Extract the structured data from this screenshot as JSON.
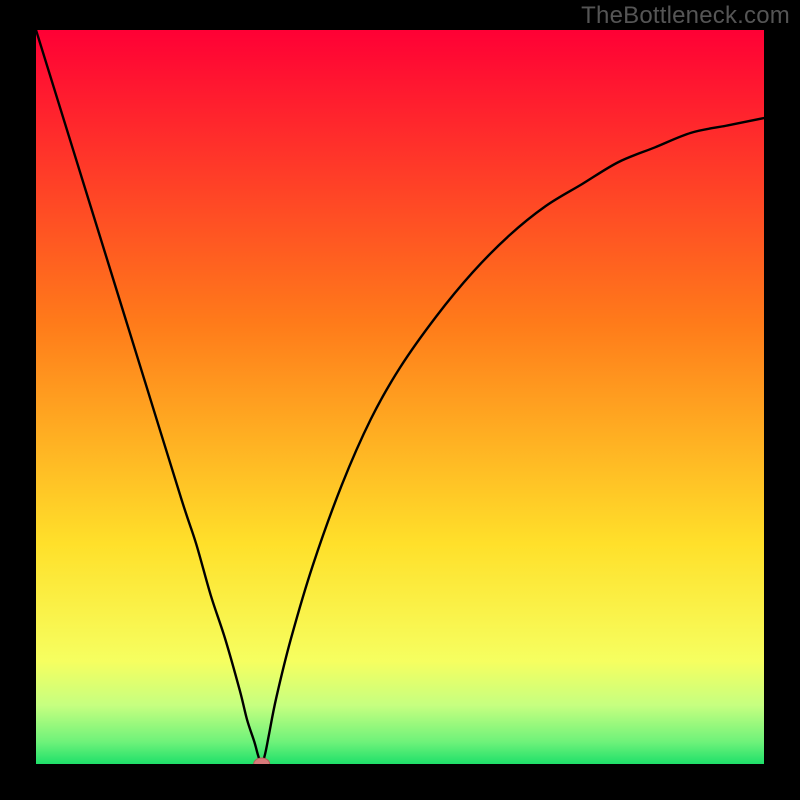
{
  "watermark": "TheBottleneck.com",
  "colors": {
    "frame": "#000000",
    "curve": "#000000",
    "marker_fill": "#d77a7a",
    "marker_stroke": "#b85a5a",
    "gradient_stops": [
      {
        "offset": 0,
        "color": "#ff0035"
      },
      {
        "offset": 40,
        "color": "#ff7b1a"
      },
      {
        "offset": 70,
        "color": "#ffe02a"
      },
      {
        "offset": 86,
        "color": "#f6ff60"
      },
      {
        "offset": 92,
        "color": "#c6ff80"
      },
      {
        "offset": 97,
        "color": "#6ef27a"
      },
      {
        "offset": 100,
        "color": "#1fe06a"
      }
    ]
  },
  "chart_data": {
    "type": "line",
    "title": "",
    "xlabel": "",
    "ylabel": "",
    "xlim": [
      0,
      100
    ],
    "ylim": [
      0,
      100
    ],
    "series": [
      {
        "name": "bottleneck-curve",
        "x": [
          0,
          5,
          10,
          15,
          20,
          22,
          24,
          26,
          28,
          29,
          30,
          30.5,
          31,
          31.5,
          32,
          33,
          35,
          38,
          42,
          46,
          50,
          55,
          60,
          65,
          70,
          75,
          80,
          85,
          90,
          95,
          100
        ],
        "y": [
          100,
          84,
          68,
          52,
          36,
          30,
          23,
          17,
          10,
          6,
          3,
          1.2,
          0,
          1.5,
          4,
          9,
          17,
          27,
          38,
          47,
          54,
          61,
          67,
          72,
          76,
          79,
          82,
          84,
          86,
          87,
          88
        ]
      }
    ],
    "marker": {
      "x": 31,
      "y": 0
    }
  }
}
